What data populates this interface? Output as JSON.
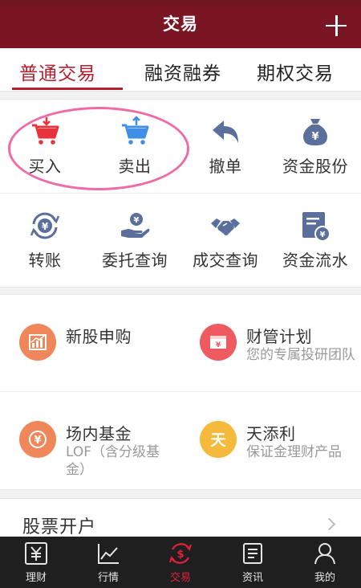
{
  "header": {
    "title": "交易",
    "add_icon": "plus-icon"
  },
  "tabs": [
    {
      "label": "普通交易",
      "active": true
    },
    {
      "label": "融资融券",
      "active": false
    },
    {
      "label": "期权交易",
      "active": false
    }
  ],
  "actions": [
    {
      "label": "买入",
      "icon": "cart-down-icon",
      "color": "#e8333d"
    },
    {
      "label": "卖出",
      "icon": "cart-up-icon",
      "color": "#3f8fe6"
    },
    {
      "label": "撤单",
      "icon": "undo-arrow-icon",
      "color": "#5a6f9b"
    },
    {
      "label": "资金股份",
      "icon": "money-bag-icon",
      "color": "#5a6f9b"
    },
    {
      "label": "转账",
      "icon": "transfer-icon",
      "color": "#5a6f9b"
    },
    {
      "label": "委托查询",
      "icon": "hand-coin-icon",
      "color": "#5a6f9b"
    },
    {
      "label": "成交查询",
      "icon": "handshake-icon",
      "color": "#5a6f9b"
    },
    {
      "label": "资金流水",
      "icon": "statement-icon",
      "color": "#5a6f9b"
    }
  ],
  "services": [
    {
      "name": "新股申购",
      "desc": "",
      "icon": "chart-icon",
      "color": "#f0875a"
    },
    {
      "name": "财管计划",
      "desc": "您的专属投研团队",
      "icon": "envelope-icon",
      "color": "#ef5a5f"
    },
    {
      "name": "场内基金",
      "desc": "LOF（含分级基金）",
      "icon": "yen-circle-icon",
      "color": "#f0875a"
    },
    {
      "name": "天添利",
      "desc": "保证金理财产品",
      "icon": "tian-icon",
      "color": "#f5b93c"
    }
  ],
  "open_account": {
    "label": "股票开户"
  },
  "bottom_nav": [
    {
      "label": "理财",
      "icon": "yen-box-icon",
      "active": false
    },
    {
      "label": "行情",
      "icon": "line-chart-icon",
      "active": false
    },
    {
      "label": "交易",
      "icon": "dollar-circle-icon",
      "active": true
    },
    {
      "label": "资讯",
      "icon": "news-icon",
      "active": false
    },
    {
      "label": "我的",
      "icon": "person-icon",
      "active": false
    }
  ]
}
